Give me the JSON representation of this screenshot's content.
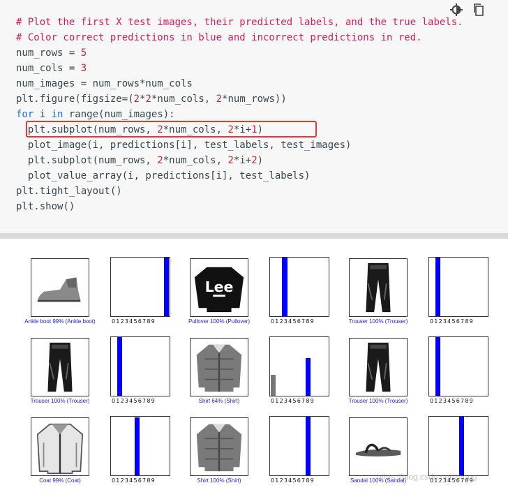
{
  "code_cell": {
    "toolbar": {
      "theme_icon": "theme-toggle-icon",
      "copy_icon": "copy-icon"
    },
    "lines": [
      [
        {
          "t": "# Plot the first X test images, their predicted labels, and the true labels.",
          "c": "cm"
        }
      ],
      [
        {
          "t": "# Color correct predictions in blue and incorrect predictions in red.",
          "c": "cm"
        }
      ],
      [
        {
          "t": "num_rows = "
        },
        {
          "t": "5",
          "c": "num"
        }
      ],
      [
        {
          "t": "num_cols = "
        },
        {
          "t": "3",
          "c": "num"
        }
      ],
      [
        {
          "t": "num_images = num_rows*num_cols"
        }
      ],
      [
        {
          "t": "plt.figure(figsize=("
        },
        {
          "t": "2",
          "c": "num"
        },
        {
          "t": "*"
        },
        {
          "t": "2",
          "c": "num"
        },
        {
          "t": "*num_cols, "
        },
        {
          "t": "2",
          "c": "num"
        },
        {
          "t": "*num_rows))"
        }
      ],
      [
        {
          "t": "for",
          "c": "kw"
        },
        {
          "t": " i "
        },
        {
          "t": "in",
          "c": "kw"
        },
        {
          "t": " range(num_images):"
        }
      ],
      [
        {
          "t": "  plt.subplot(num_rows, "
        },
        {
          "t": "2",
          "c": "num"
        },
        {
          "t": "*num_cols, "
        },
        {
          "t": "2",
          "c": "num"
        },
        {
          "t": "*i+"
        },
        {
          "t": "1",
          "c": "num"
        },
        {
          "t": ")"
        }
      ],
      [
        {
          "t": "  plot_image(i, predictions[i], test_labels, test_images)"
        }
      ],
      [
        {
          "t": "  plt.subplot(num_rows, "
        },
        {
          "t": "2",
          "c": "num"
        },
        {
          "t": "*num_cols, "
        },
        {
          "t": "2",
          "c": "num"
        },
        {
          "t": "*i+"
        },
        {
          "t": "2",
          "c": "num"
        },
        {
          "t": ")"
        }
      ],
      [
        {
          "t": "  plot_value_array(i, predictions[i], test_labels)"
        }
      ],
      [
        {
          "t": "plt.tight_layout()"
        }
      ],
      [
        {
          "t": "plt.show()"
        }
      ]
    ],
    "highlighted_line_index": 7
  },
  "output": {
    "tick_labels": "0123456789",
    "bar_color": "#0000ff",
    "gray_bar_color": "#777777",
    "label_color": "#1c1ce0",
    "items": [
      {
        "label": "Ankle boot 99% (Ankle boot)",
        "image_icon": "ankle-boot-image",
        "bars": [
          {
            "i": 9,
            "v": 1.0,
            "c": "blue"
          }
        ]
      },
      {
        "label": "Pullover 100% (Pullover)",
        "image_icon": "pullover-image",
        "bars": [
          {
            "i": 2,
            "v": 1.0,
            "c": "blue"
          }
        ]
      },
      {
        "label": "Trouser 100% (Trouser)",
        "image_icon": "trouser-image",
        "bars": [
          {
            "i": 1,
            "v": 1.0,
            "c": "blue"
          }
        ]
      },
      {
        "label": "Trouser 100% (Trouser)",
        "image_icon": "trouser-image",
        "bars": [
          {
            "i": 1,
            "v": 1.0,
            "c": "blue"
          }
        ]
      },
      {
        "label": "Shirt 64% (Shirt)",
        "image_icon": "shirt-image",
        "bars": [
          {
            "i": 0,
            "v": 0.36,
            "c": "gray"
          },
          {
            "i": 6,
            "v": 0.64,
            "c": "blue"
          }
        ]
      },
      {
        "label": "Trouser 100% (Trouser)",
        "image_icon": "trouser-image",
        "bars": [
          {
            "i": 1,
            "v": 1.0,
            "c": "blue"
          }
        ]
      },
      {
        "label": "Coat 99% (Coat)",
        "image_icon": "coat-image",
        "bars": [
          {
            "i": 4,
            "v": 0.99,
            "c": "blue"
          }
        ]
      },
      {
        "label": "Shirt 100% (Shirt)",
        "image_icon": "shirt-image",
        "bars": [
          {
            "i": 6,
            "v": 1.0,
            "c": "blue"
          }
        ]
      },
      {
        "label": "Sandal 100% (Sandal)",
        "image_icon": "sandal-image",
        "bars": [
          {
            "i": 5,
            "v": 1.0,
            "c": "blue"
          }
        ]
      }
    ]
  },
  "watermark": "https://blog.csdn.net/zhong"
}
